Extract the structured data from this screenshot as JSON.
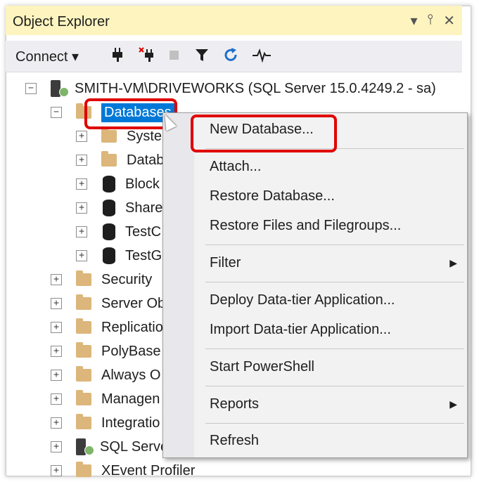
{
  "panel": {
    "title": "Object Explorer",
    "title_icons": [
      "▾",
      "⫯",
      "✕"
    ]
  },
  "toolbar": {
    "connect_label": "Connect ▾",
    "icons": [
      "connect-plug-icon",
      "disconnect-icon",
      "stop-icon",
      "filter-icon",
      "refresh-icon",
      "activity-monitor-icon"
    ]
  },
  "tree": {
    "server_label": "SMITH-VM\\DRIVEWORKS (SQL Server 15.0.4249.2 - sa)",
    "databases_label": "Databases",
    "db_children": [
      "Syster",
      "Datab",
      "Block",
      "Share",
      "TestC",
      "TestG"
    ],
    "server_children": [
      "Security",
      "Server Ob",
      "Replicatio",
      "PolyBase",
      "Always O",
      "Managen",
      "Integratio",
      "SQL Serve",
      "XEvent Profiler"
    ]
  },
  "context_menu": {
    "items": [
      "New Database...",
      "Attach...",
      "Restore Database...",
      "Restore Files and Filegroups...",
      "Filter",
      "Deploy Data-tier Application...",
      "Import Data-tier Application...",
      "Start PowerShell",
      "Reports",
      "Refresh"
    ]
  },
  "colors": {
    "title_bg": "#fdf4bf",
    "selection": "#0078d7",
    "highlight_box": "#e00000"
  }
}
